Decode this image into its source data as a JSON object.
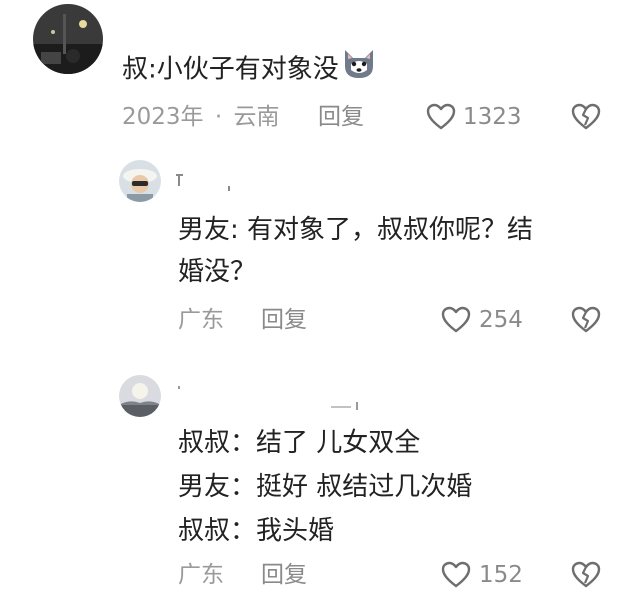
{
  "comments": [
    {
      "text_main": "叔:小伙子有对象没",
      "emoji": "husky-face-icon",
      "meta_date": "2023年",
      "meta_sep": "·",
      "meta_location": "云南",
      "reply_label": "回复",
      "like_count": "1323"
    },
    {
      "text_line1": "男友: 有对象了，叔叔你呢？结",
      "text_line2": "婚没？",
      "meta_location": "广东",
      "reply_label": "回复",
      "like_count": "254"
    },
    {
      "text_line1": "叔叔：结了 儿女双全",
      "text_line2": "男友：挺好 叔结过几次婚",
      "text_line3": "叔叔：我头婚",
      "meta_location": "广东",
      "reply_label": "回复",
      "like_count": "152"
    }
  ],
  "colors": {
    "text": "#222222",
    "meta": "#9a9a9a",
    "icon": "#7a7a7a"
  }
}
